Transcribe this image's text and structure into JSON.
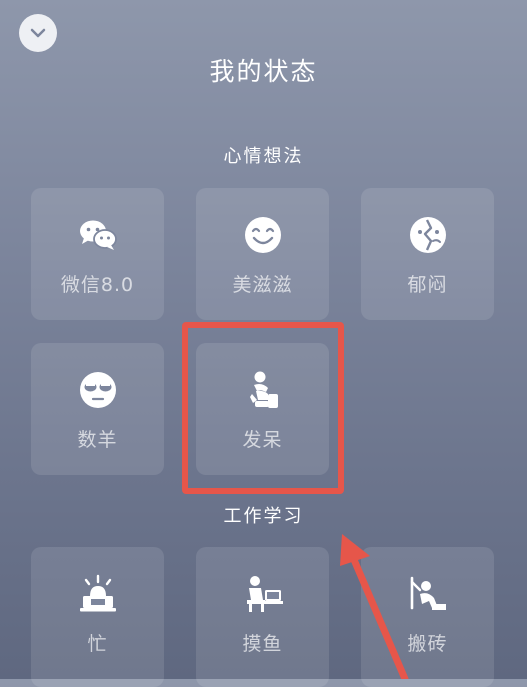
{
  "header": {
    "title": "我的状态",
    "collapse_icon": "chevron-down-icon"
  },
  "sections": [
    {
      "title": "心情想法",
      "items": [
        {
          "label": "微信8.0",
          "icon": "wechat-icon"
        },
        {
          "label": "美滋滋",
          "icon": "smile-icon"
        },
        {
          "label": "郁闷",
          "icon": "broken-heart-icon"
        },
        {
          "label": "数羊",
          "icon": "sleepy-face-icon"
        },
        {
          "label": "发呆",
          "icon": "daze-person-icon"
        }
      ]
    },
    {
      "title": "工作学习",
      "items": [
        {
          "label": "忙",
          "icon": "busy-laptop-icon"
        },
        {
          "label": "摸鱼",
          "icon": "slacking-person-icon"
        },
        {
          "label": "搬砖",
          "icon": "brick-moving-icon"
        }
      ]
    }
  ],
  "annotation": {
    "highlight_color": "#e6564a",
    "highlighted_item": "发呆"
  },
  "colors": {
    "background_top": "#8e97ab",
    "background_bottom": "#5f6880",
    "tile": "rgba(255,255,255,0.11)",
    "icon": "#ffffff"
  }
}
